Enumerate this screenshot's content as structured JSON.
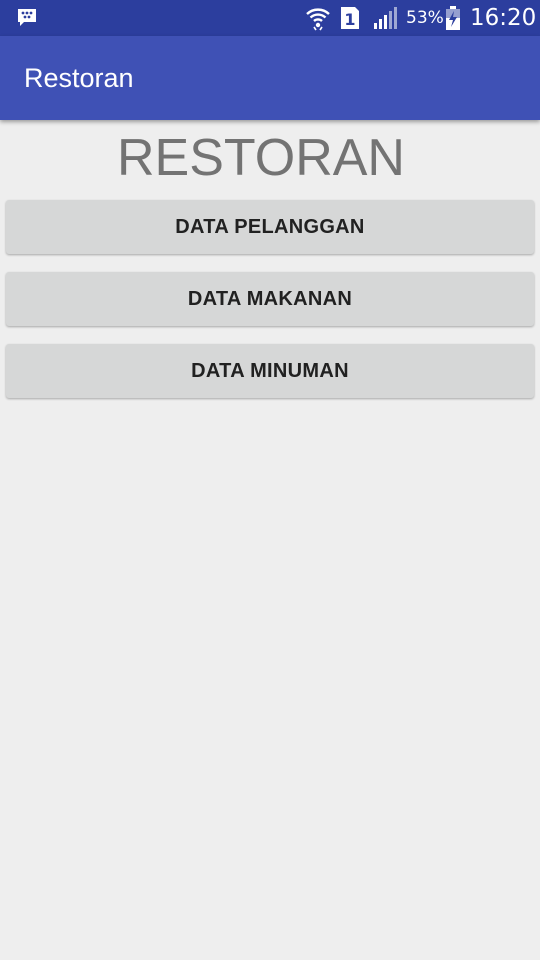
{
  "status_bar": {
    "battery_percent": "53%",
    "time": "16:20",
    "sim_slot": "1",
    "icons": [
      "bbm-icon",
      "wifi-icon",
      "sim-icon",
      "signal-icon",
      "battery-charging-icon"
    ]
  },
  "app_bar": {
    "title": "Restoran",
    "color": "#3f51b5"
  },
  "main": {
    "heading": "RESTORAN",
    "buttons": [
      {
        "label": "DATA PELANGGAN"
      },
      {
        "label": "DATA MAKANAN"
      },
      {
        "label": "DATA MINUMAN"
      }
    ]
  },
  "colors": {
    "status_bar": "#2c3e9e",
    "background": "#eeeeee",
    "button": "#d6d7d7"
  }
}
